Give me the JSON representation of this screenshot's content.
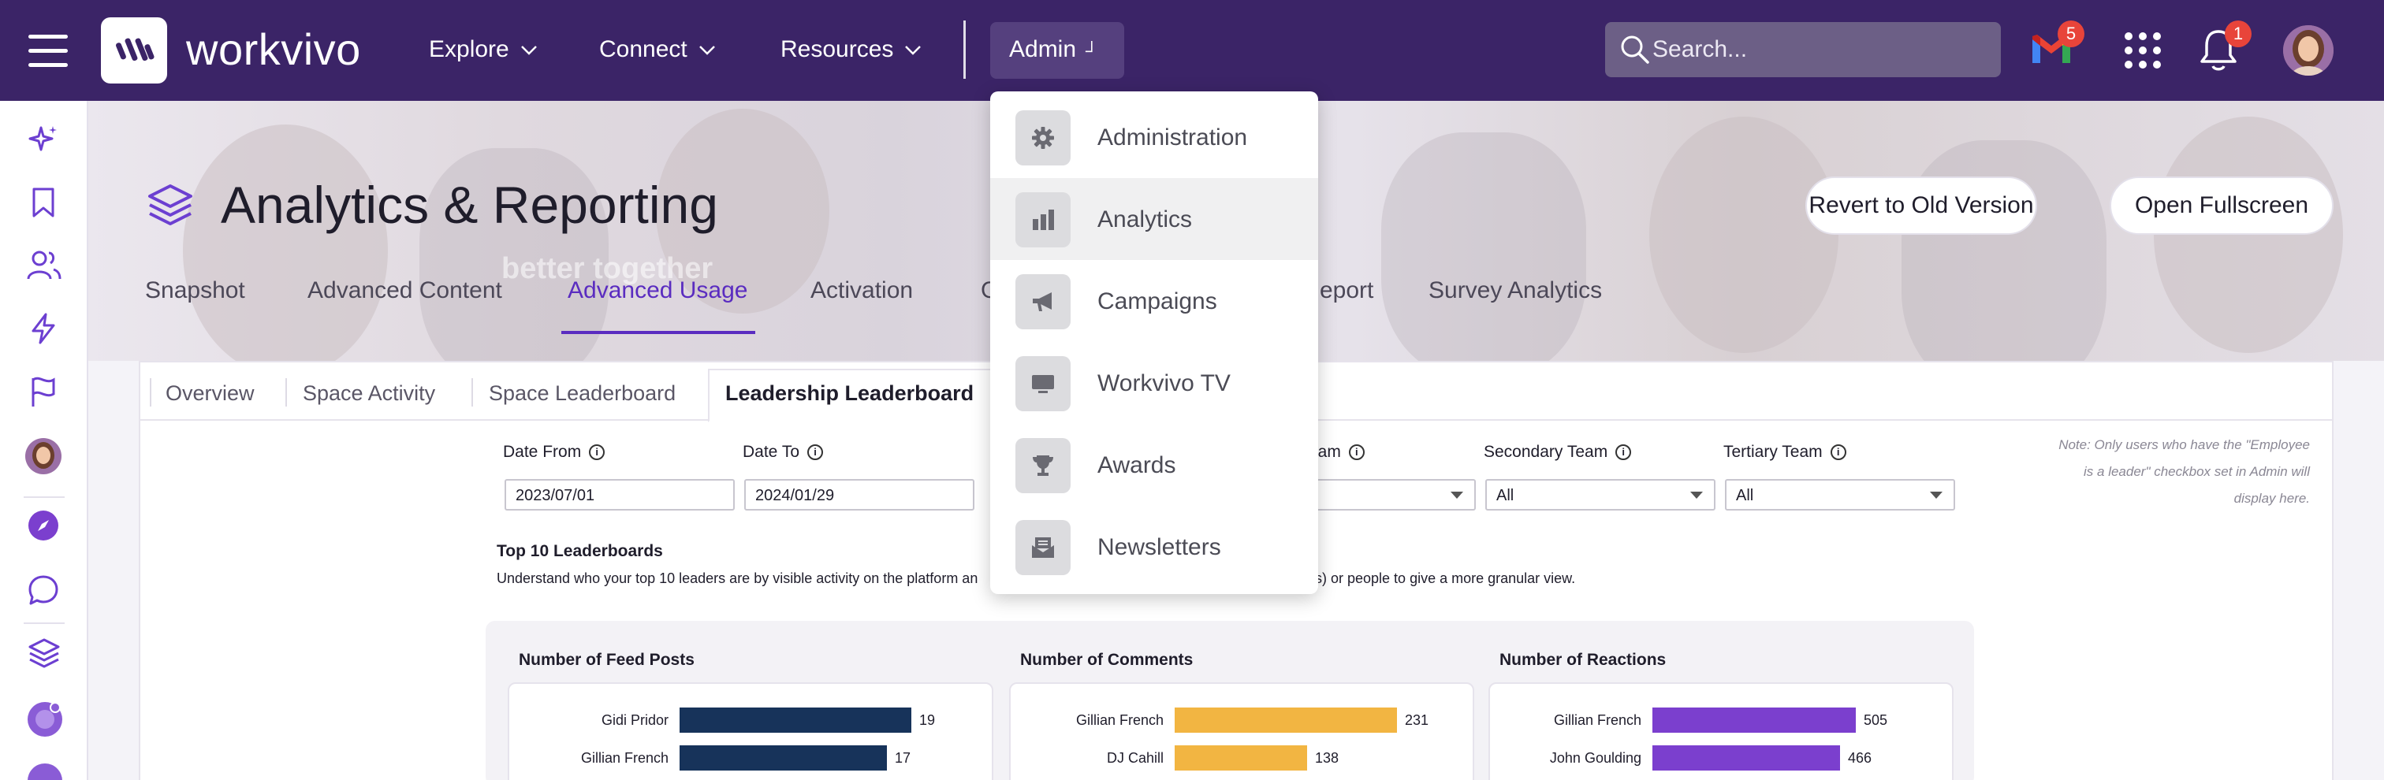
{
  "app": {
    "name": "workvivo"
  },
  "topnav": {
    "items": [
      {
        "label": "Explore"
      },
      {
        "label": "Connect"
      },
      {
        "label": "Resources"
      }
    ],
    "admin_label": "Admin",
    "search_placeholder": "Search...",
    "gmail_badge": "5",
    "notifications_badge": "1"
  },
  "admin_menu": {
    "items": [
      {
        "label": "Administration",
        "icon": "gear-icon"
      },
      {
        "label": "Analytics",
        "icon": "bar-chart-icon"
      },
      {
        "label": "Campaigns",
        "icon": "megaphone-icon"
      },
      {
        "label": "Workvivo TV",
        "icon": "tv-icon"
      },
      {
        "label": "Awards",
        "icon": "trophy-icon"
      },
      {
        "label": "Newsletters",
        "icon": "newsletter-icon"
      }
    ],
    "hovered_index": 1
  },
  "page": {
    "title": "Analytics & Reporting",
    "banner_text": "better together",
    "revert_label": "Revert to Old Version",
    "fullscreen_label": "Open Fullscreen",
    "tabs": [
      {
        "label": "Snapshot"
      },
      {
        "label": "Advanced Content"
      },
      {
        "label": "Advanced Usage"
      },
      {
        "label": "Activation"
      },
      {
        "label": "G"
      },
      {
        "label": "eport"
      },
      {
        "label": "Survey Analytics"
      }
    ],
    "active_tab_index": 2
  },
  "report": {
    "subtabs": [
      {
        "label": "Overview"
      },
      {
        "label": "Space Activity"
      },
      {
        "label": "Space Leaderboard"
      },
      {
        "label": "Leadership Leaderboard"
      }
    ],
    "active_subtab_index": 3,
    "filters": {
      "date_from_label": "Date From",
      "date_from_value": "2023/07/01",
      "date_to_label": "Date To",
      "date_to_value": "2024/01/29",
      "team_label": "eam",
      "secondary_team_label": "Secondary Team",
      "secondary_team_value": "All",
      "tertiary_team_label": "Tertiary Team",
      "tertiary_team_value": "All"
    },
    "note": "Note: Only users who have the \"Employee is a leader\" checkbox set in Admin will display here.",
    "section_title": "Top 10 Leaderboards",
    "section_desc": "Understand who your top 10 leaders are by visible activity on the platform an",
    "section_desc_tail": "n(s) or people to give a more granular view."
  },
  "chart_data": [
    {
      "type": "bar",
      "title": "Number of Feed Posts",
      "categories": [
        "Gidi Pridor",
        "Gillian French"
      ],
      "values": [
        19,
        17
      ],
      "color": "#17335a"
    },
    {
      "type": "bar",
      "title": "Number of Comments",
      "categories": [
        "Gillian French",
        "DJ Cahill"
      ],
      "values": [
        231,
        138
      ],
      "color": "#f2b542"
    },
    {
      "type": "bar",
      "title": "Number of Reactions",
      "categories": [
        "Gillian French",
        "John Goulding"
      ],
      "values": [
        505,
        466
      ],
      "color": "#7b3fce"
    }
  ]
}
